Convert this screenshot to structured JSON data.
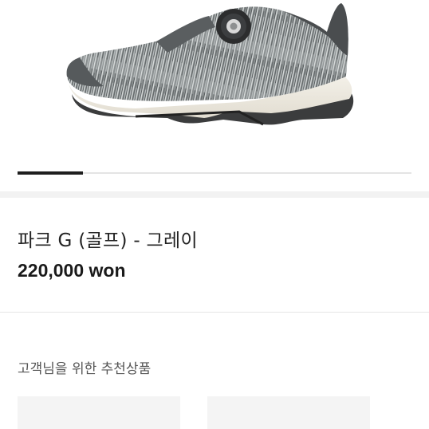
{
  "product": {
    "name": "파크 G (골프) - 그레이",
    "price": "220,000 won"
  },
  "gallery": {
    "image": "gray knit golf shoe with dial lace system",
    "active_slide": 1
  },
  "recommendations": {
    "title": "고객님을 위한 추천상품",
    "items": [
      {},
      {}
    ]
  },
  "colors": {
    "text": "#222222",
    "secondary_text": "#555555",
    "indicator_active": "#1e1e1e",
    "indicator_track": "#e4e4e4",
    "section_band": "#f2f2f2"
  }
}
